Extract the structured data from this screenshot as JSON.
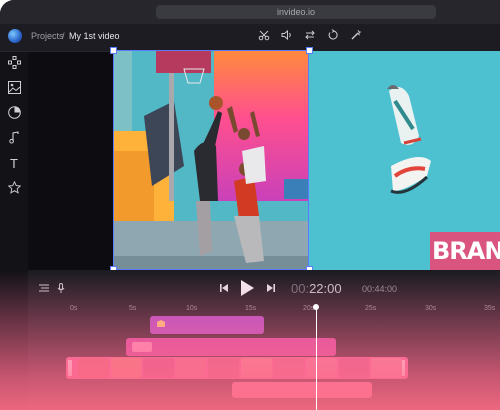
{
  "browser": {
    "url": "invideo.io"
  },
  "header": {
    "breadcrumb_root": "Projects",
    "separator": "/",
    "project_name": "My 1st video",
    "toolbar_icons": [
      "trim-icon",
      "volume-icon",
      "swap-icon",
      "rotate-icon",
      "magic-wand-icon"
    ]
  },
  "sidebar": {
    "icons": [
      "layout-icon",
      "media-icon",
      "sticker-icon",
      "music-icon",
      "text-icon",
      "star-icon"
    ],
    "text_glyph": "T"
  },
  "canvas": {
    "brand_text": "BRAND",
    "colors": {
      "selection": "#5b7bff",
      "brand_bg": "#d9557f",
      "sky": "#4ec1d0"
    }
  },
  "player": {
    "current_time_dim": "00:",
    "current_time": "22:00",
    "total_time": "00:44:00",
    "ruler_labels": [
      "0s",
      "5s",
      "10s",
      "15s",
      "20s",
      "25s",
      "30s",
      "35s"
    ]
  },
  "timeline": {
    "colors": {
      "music": "#b04cc9",
      "text": "#d24aa4",
      "video": "#f06ba0"
    }
  }
}
